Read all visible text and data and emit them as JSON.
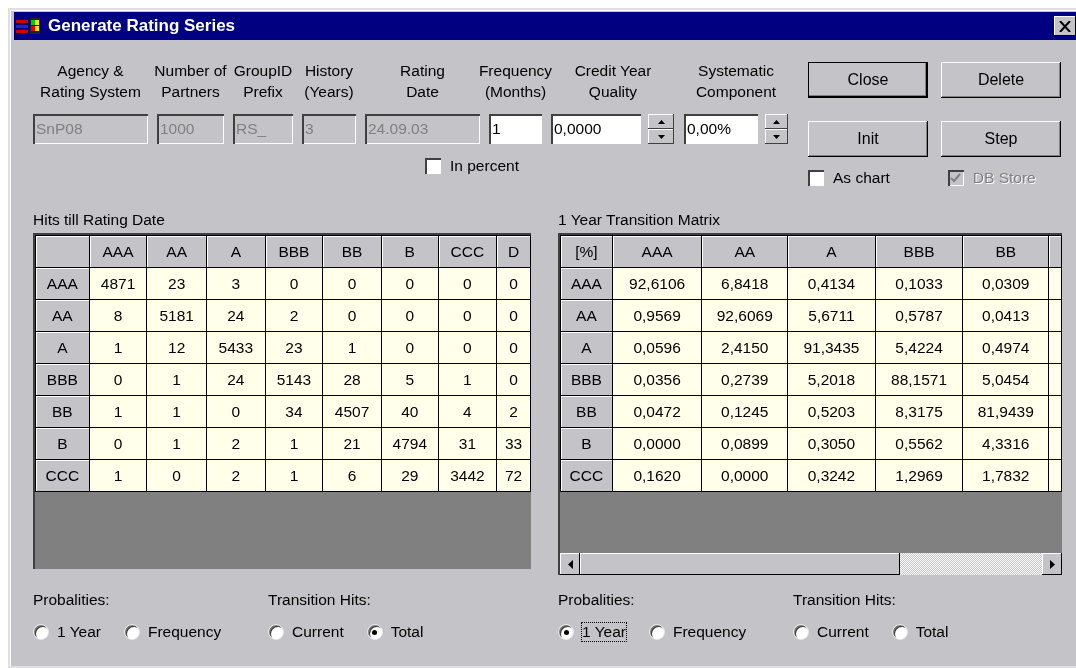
{
  "window": {
    "title": "Generate Rating Series"
  },
  "parameters": [
    {
      "label": "Agency &\nRating System",
      "value": "SnP08",
      "disabled": true,
      "kind": "text"
    },
    {
      "label": "Number of\nPartners",
      "value": "1000",
      "disabled": true,
      "kind": "text"
    },
    {
      "label": "GroupID\nPrefix",
      "value": "RS_",
      "disabled": true,
      "kind": "text"
    },
    {
      "label": "History\n(Years)",
      "value": "3",
      "disabled": true,
      "kind": "text"
    },
    {
      "label": "Rating\nDate",
      "value": "24.09.03",
      "disabled": true,
      "kind": "text"
    },
    {
      "label": "Frequency\n(Months)",
      "value": "1",
      "disabled": false,
      "kind": "text"
    },
    {
      "label": "Credit Year\nQuality",
      "value": "0,0000",
      "disabled": false,
      "kind": "spin"
    },
    {
      "label": "Systematic\nComponent",
      "value": "0,00%",
      "disabled": false,
      "kind": "spin"
    }
  ],
  "in_percent": {
    "label": "In percent",
    "checked": false,
    "disabled": false
  },
  "buttons": [
    {
      "label": "Close",
      "default": true
    },
    {
      "label": "Delete",
      "default": false
    },
    {
      "label": "Init",
      "default": false
    },
    {
      "label": "Step",
      "default": false
    }
  ],
  "button_options": [
    {
      "label": "As chart",
      "checked": false,
      "disabled": false
    },
    {
      "label": "DB Store",
      "checked": true,
      "disabled": true
    }
  ],
  "panels": [
    {
      "title": "Hits till Rating Date",
      "horizontal_scrollbar": false,
      "columns": [
        "AAA",
        "AA",
        "A",
        "BBB",
        "BB",
        "B",
        "CCC",
        "D"
      ],
      "rows": [
        {
          "label": "AAA",
          "cells": [
            "4871",
            "23",
            "3",
            "0",
            "0",
            "0",
            "0",
            "0"
          ]
        },
        {
          "label": "AA",
          "cells": [
            "8",
            "5181",
            "24",
            "2",
            "0",
            "0",
            "0",
            "0"
          ]
        },
        {
          "label": "A",
          "cells": [
            "1",
            "12",
            "5433",
            "23",
            "1",
            "0",
            "0",
            "0"
          ]
        },
        {
          "label": "BBB",
          "cells": [
            "0",
            "1",
            "24",
            "5143",
            "28",
            "5",
            "1",
            "0"
          ]
        },
        {
          "label": "BB",
          "cells": [
            "1",
            "1",
            "0",
            "34",
            "4507",
            "40",
            "4",
            "2"
          ]
        },
        {
          "label": "B",
          "cells": [
            "0",
            "1",
            "2",
            "1",
            "21",
            "4794",
            "31",
            "33"
          ]
        },
        {
          "label": "CCC",
          "cells": [
            "1",
            "0",
            "2",
            "1",
            "6",
            "29",
            "3442",
            "72"
          ]
        }
      ],
      "radio_groups": [
        {
          "label": "Probalities:",
          "options": [
            {
              "label": "1 Year",
              "selected": false,
              "focused": false
            },
            {
              "label": "Frequency",
              "selected": false,
              "focused": false
            }
          ]
        },
        {
          "label": "Transition Hits:",
          "options": [
            {
              "label": "Current",
              "selected": false,
              "focused": false
            },
            {
              "label": "Total",
              "selected": true,
              "focused": false
            }
          ]
        }
      ]
    },
    {
      "title": "1 Year Transition Matrix",
      "corner": "[%]",
      "horizontal_scrollbar": true,
      "columns": [
        "AAA",
        "AA",
        "A",
        "BBB",
        "BB"
      ],
      "rows": [
        {
          "label": "AAA",
          "cells": [
            "92,6106",
            "6,8418",
            "0,4134",
            "0,1033",
            "0,0309"
          ]
        },
        {
          "label": "AA",
          "cells": [
            "0,9569",
            "92,6069",
            "5,6711",
            "0,5787",
            "0,0413"
          ]
        },
        {
          "label": "A",
          "cells": [
            "0,0596",
            "2,4150",
            "91,3435",
            "5,4224",
            "0,4974"
          ]
        },
        {
          "label": "BBB",
          "cells": [
            "0,0356",
            "0,2739",
            "5,2018",
            "88,1571",
            "5,0454"
          ]
        },
        {
          "label": "BB",
          "cells": [
            "0,0472",
            "0,1245",
            "0,5203",
            "8,3175",
            "81,9439"
          ]
        },
        {
          "label": "B",
          "cells": [
            "0,0000",
            "0,0899",
            "0,3050",
            "0,5562",
            "4,3316"
          ]
        },
        {
          "label": "CCC",
          "cells": [
            "0,1620",
            "0,0000",
            "0,3242",
            "1,2969",
            "1,7832"
          ]
        }
      ],
      "radio_groups": [
        {
          "label": "Probalities:",
          "options": [
            {
              "label": "1 Year",
              "selected": true,
              "focused": true
            },
            {
              "label": "Frequency",
              "selected": false,
              "focused": false
            }
          ]
        },
        {
          "label": "Transition Hits:",
          "options": [
            {
              "label": "Current",
              "selected": false,
              "focused": false
            },
            {
              "label": "Total",
              "selected": false,
              "focused": false
            }
          ]
        }
      ]
    }
  ]
}
